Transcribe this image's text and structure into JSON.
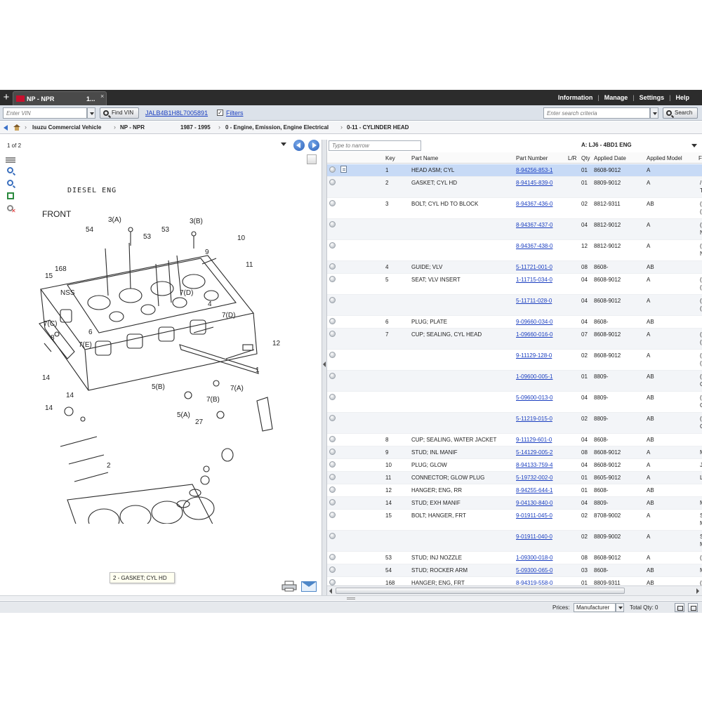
{
  "tab": {
    "logo_text": "",
    "title": "NP - NPR",
    "extra": "1...",
    "close": "×"
  },
  "top_menu": [
    "Information",
    "Manage",
    "Settings",
    "Help"
  ],
  "toolbar": {
    "vin_placeholder": "Enter VIN",
    "find_vin_label": "Find VIN",
    "vin_value": "JALB4B1H8L7005891",
    "filters_label": "Filters",
    "filters_checked": "✓",
    "search_placeholder": "Enter search criteria",
    "search_label": "Search"
  },
  "breadcrumb": {
    "items": [
      "Isuzu Commercial Vehicle",
      "NP - NPR",
      "1987 - 1995",
      "0 - Engine, Emission, Engine Electrical",
      "0-11 - CYLINDER HEAD"
    ]
  },
  "left": {
    "page_indicator": "1 of 2"
  },
  "diagram": {
    "title": "DIESEL ENG",
    "labels": [
      "FRONT",
      "54",
      "3(A)",
      "53",
      "53",
      "3(B)",
      "10",
      "9",
      "11",
      "168",
      "15",
      "NSS",
      "7(D)",
      "4",
      "7(D)",
      "7(C)",
      "6",
      "8",
      "7(E)",
      "12",
      "1",
      "14",
      "14",
      "14",
      "5(B)",
      "7(A)",
      "7(B)",
      "5(A)",
      "27",
      "2"
    ],
    "tooltip": "2 - GASKET;  CYL HD"
  },
  "right": {
    "narrow_placeholder": "Type to narrow",
    "model_label": "A: LJ6 - 4BD1 ENG"
  },
  "columns": {
    "key": "Key",
    "part_name": "Part Name",
    "part_number": "Part Number",
    "lr": "L/R",
    "qty": "Qty",
    "applied_date": "Applied Date",
    "applied_model": "Applied Model",
    "extra": "F"
  },
  "rows": [
    {
      "key": "1",
      "name": "HEAD ASM;  CYL",
      "pn": "8-94256-853-1",
      "qty": "01",
      "date": "8608-9012",
      "model": "A",
      "extra": "",
      "extra2": ""
    },
    {
      "key": "2",
      "name": "GASKET;  CYL HD",
      "pn": "8-94145-839-0",
      "qty": "01",
      "date": "8809-9012",
      "model": "A",
      "extra": "/",
      "extra2": "T"
    },
    {
      "key": "3",
      "name": "BOLT;  CYL HD TO BLOCK",
      "pn": "8-94367-436-0",
      "qty": "02",
      "date": "8812-9311",
      "model": "AB",
      "extra": "(",
      "extra2": "("
    },
    {
      "key": "",
      "name": "",
      "pn": "8-94367-437-0",
      "qty": "04",
      "date": "8812-9012",
      "model": "A",
      "extra": "(",
      "extra2": "N"
    },
    {
      "key": "",
      "name": "",
      "pn": "8-94367-438-0",
      "qty": "12",
      "date": "8812-9012",
      "model": "A",
      "extra": "(",
      "extra2": "N"
    },
    {
      "key": "4",
      "name": "GUIDE;  VLV",
      "pn": "5-11721-001-0",
      "qty": "08",
      "date": "8608-",
      "model": "AB",
      "extra": "",
      "extra2": ""
    },
    {
      "key": "5",
      "name": "SEAT;  VLV INSERT",
      "pn": "1-11715-034-0",
      "qty": "04",
      "date": "8608-9012",
      "model": "A",
      "extra": "(",
      "extra2": "("
    },
    {
      "key": "",
      "name": "",
      "pn": "5-11711-028-0",
      "qty": "04",
      "date": "8608-9012",
      "model": "A",
      "extra": "(",
      "extra2": "("
    },
    {
      "key": "6",
      "name": "PLUG;  PLATE",
      "pn": "9-09660-034-0",
      "qty": "04",
      "date": "8608-",
      "model": "AB",
      "extra": "",
      "extra2": ""
    },
    {
      "key": "7",
      "name": "CUP;  SEALING, CYL HEAD",
      "pn": "1-09660-016-0",
      "qty": "07",
      "date": "8608-9012",
      "model": "A",
      "extra": "(",
      "extra2": "("
    },
    {
      "key": "",
      "name": "",
      "pn": "9-11129-128-0",
      "qty": "02",
      "date": "8608-9012",
      "model": "A",
      "extra": "(",
      "extra2": "("
    },
    {
      "key": "",
      "name": "",
      "pn": "1-09600-005-1",
      "qty": "01",
      "date": "8809-",
      "model": "AB",
      "extra": "(",
      "extra2": "C"
    },
    {
      "key": "",
      "name": "",
      "pn": "5-09600-013-0",
      "qty": "04",
      "date": "8809-",
      "model": "AB",
      "extra": "(",
      "extra2": "C"
    },
    {
      "key": "",
      "name": "",
      "pn": "5-11219-015-0",
      "qty": "02",
      "date": "8809-",
      "model": "AB",
      "extra": "(",
      "extra2": "C"
    },
    {
      "key": "8",
      "name": "CUP;  SEALING, WATER JACKET",
      "pn": "9-11129-601-0",
      "qty": "04",
      "date": "8608-",
      "model": "AB",
      "extra": "",
      "extra2": ""
    },
    {
      "key": "9",
      "name": "STUD;  INL MANIF",
      "pn": "5-14129-005-2",
      "qty": "08",
      "date": "8608-9012",
      "model": "A",
      "extra": "M",
      "extra2": ""
    },
    {
      "key": "10",
      "name": "PLUG;  GLOW",
      "pn": "8-94133-759-4",
      "qty": "04",
      "date": "8608-9012",
      "model": "A",
      "extra": "J",
      "extra2": ""
    },
    {
      "key": "11",
      "name": "CONNECTOR;  GLOW PLUG",
      "pn": "5-19732-002-0",
      "qty": "01",
      "date": "8605-9012",
      "model": "A",
      "extra": "L",
      "extra2": ""
    },
    {
      "key": "12",
      "name": "HANGER;  ENG, RR",
      "pn": "8-94255-644-1",
      "qty": "01",
      "date": "8608-",
      "model": "AB",
      "extra": "",
      "extra2": ""
    },
    {
      "key": "14",
      "name": "STUD;  EXH MANIF",
      "pn": "9-04130-840-0",
      "qty": "04",
      "date": "8809-",
      "model": "AB",
      "extra": "M",
      "extra2": ""
    },
    {
      "key": "15",
      "name": "BOLT;  HANGER, FRT",
      "pn": "9-01911-045-0",
      "qty": "02",
      "date": "8708-9002",
      "model": "A",
      "extra": "S",
      "extra2": "M"
    },
    {
      "key": "",
      "name": "",
      "pn": "9-01911-040-0",
      "qty": "02",
      "date": "8809-9002",
      "model": "A",
      "extra": "S",
      "extra2": "M"
    },
    {
      "key": "53",
      "name": "STUD;  INJ NOZZLE",
      "pn": "1-09300-018-0",
      "qty": "08",
      "date": "8608-9012",
      "model": "A",
      "extra": "(",
      "extra2": ""
    },
    {
      "key": "54",
      "name": "STUD;  ROCKER ARM",
      "pn": "5-09300-065-0",
      "qty": "03",
      "date": "8608-",
      "model": "AB",
      "extra": "M",
      "extra2": ""
    },
    {
      "key": "168",
      "name": "HANGER;  ENG, FRT",
      "pn": "8-94319-558-0",
      "qty": "01",
      "date": "8809-9311",
      "model": "AB",
      "extra": "(",
      "extra2": ""
    }
  ],
  "status": {
    "prices_label": "Prices:",
    "prices_value": "Manufacturer",
    "total_qty": "Total Qty: 0"
  },
  "colors": {
    "topbar": "#2c2c2c",
    "link": "#1a3ec0",
    "selected_row": "#c7daf6",
    "accent": "#3a70c8"
  }
}
